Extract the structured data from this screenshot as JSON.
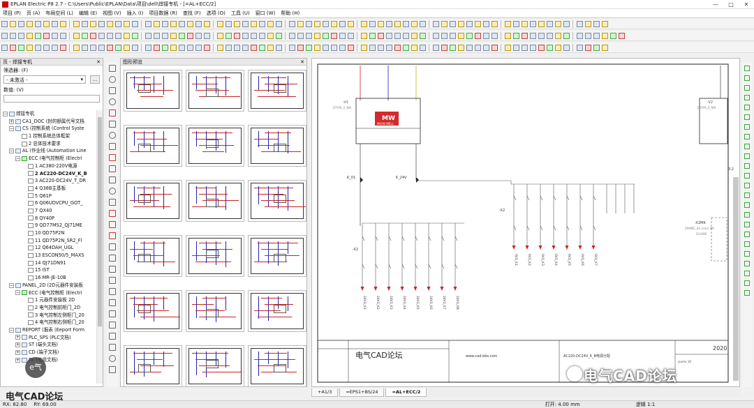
{
  "window": {
    "title": "EPLAN Electric P8 2.7 - C:\\Users\\Public\\EPLAN\\Data\\项目\\dell\\焊接专机 - [=AL+ECC/2]",
    "controls": [
      "—",
      "□",
      "✕"
    ]
  },
  "menu": [
    "项目 (P)",
    "页 (A)",
    "布局空间 (L)",
    "编辑 (E)",
    "视图 (V)",
    "插入 (I)",
    "项目数据 (R)",
    "查找 (F)",
    "选项 (O)",
    "工具 (U)",
    "窗口 (W)",
    "帮助 (H)"
  ],
  "left_panel": {
    "header": "页 - 焊接专机",
    "filter_label": "筛选器: (F)",
    "filter_value": "- 未激活 -",
    "filter_btn": "...",
    "value_label": "数值: (V)",
    "tree": [
      {
        "depth": 0,
        "toggle": "⊟",
        "icon": "proj",
        "label": "焊接专机"
      },
      {
        "depth": 1,
        "toggle": "⊞",
        "icon": "folder",
        "label": "CA1_DOC (封的额属代号文档"
      },
      {
        "depth": 1,
        "toggle": "⊟",
        "icon": "folder",
        "label": "CS (控制系统 (Control Syste"
      },
      {
        "depth": 2,
        "toggle": "",
        "icon": "page",
        "label": "1 控制系统总体框架"
      },
      {
        "depth": 2,
        "toggle": "",
        "icon": "page",
        "label": "2 总体技术要求"
      },
      {
        "depth": 1,
        "toggle": "⊟",
        "icon": "folder",
        "label": "AL (作业线 (Automation Line"
      },
      {
        "depth": 2,
        "toggle": "⊟",
        "icon": "green",
        "label": "ECC (电气控制柜 (Electri"
      },
      {
        "depth": 3,
        "toggle": "",
        "icon": "page",
        "label": "1 AC380-220V电源"
      },
      {
        "depth": 3,
        "toggle": "",
        "icon": "page",
        "label": "2 AC220-DC24V_K_B",
        "bold": true
      },
      {
        "depth": 3,
        "toggle": "",
        "icon": "page",
        "label": "3 AC220-DC24V_T_DR"
      },
      {
        "depth": 3,
        "toggle": "",
        "icon": "page",
        "label": "4 Q38B主基板"
      },
      {
        "depth": 3,
        "toggle": "",
        "icon": "page",
        "label": "5 Q61P"
      },
      {
        "depth": 3,
        "toggle": "",
        "icon": "page",
        "label": "6 Q06UDVCPU_GOT_"
      },
      {
        "depth": 3,
        "toggle": "",
        "icon": "page",
        "label": "7 QX40"
      },
      {
        "depth": 3,
        "toggle": "",
        "icon": "page",
        "label": "8 QY40P"
      },
      {
        "depth": 3,
        "toggle": "",
        "icon": "page",
        "label": "9 QD77MS2_QJ71ME"
      },
      {
        "depth": 3,
        "toggle": "",
        "icon": "page",
        "label": "10 QD75P2N"
      },
      {
        "depth": 3,
        "toggle": "",
        "icon": "page",
        "label": "11 QD75P2N_SR2_Fl"
      },
      {
        "depth": 3,
        "toggle": "",
        "icon": "page",
        "label": "12 Q64DAH_UGL"
      },
      {
        "depth": 3,
        "toggle": "",
        "icon": "page",
        "label": "13 ESCON50/5_MAXS"
      },
      {
        "depth": 3,
        "toggle": "",
        "icon": "page",
        "label": "14 QJ71DN91"
      },
      {
        "depth": 3,
        "toggle": "",
        "icon": "page",
        "label": "15 IST"
      },
      {
        "depth": 3,
        "toggle": "",
        "icon": "page",
        "label": "16 MR-JE-10B"
      },
      {
        "depth": 1,
        "toggle": "⊟",
        "icon": "folder",
        "label": "PANEL_2D (2D元器件安装板"
      },
      {
        "depth": 2,
        "toggle": "⊟",
        "icon": "green",
        "label": "ECC (电气控制柜 (Electri"
      },
      {
        "depth": 3,
        "toggle": "",
        "icon": "page",
        "label": "1 元器件安装板 2D"
      },
      {
        "depth": 3,
        "toggle": "",
        "icon": "page",
        "label": "2 电气控制前柜门_2D"
      },
      {
        "depth": 3,
        "toggle": "",
        "icon": "page",
        "label": "3 电气控制左侧柜门_20"
      },
      {
        "depth": 3,
        "toggle": "",
        "icon": "page",
        "label": "4 电气控制右侧柜门_20"
      },
      {
        "depth": 1,
        "toggle": "⊟",
        "icon": "folder",
        "label": "REPORT (报表 (Eeport Form"
      },
      {
        "depth": 2,
        "toggle": "⊞",
        "icon": "folder",
        "label": "PLC_SPS (PLC文档)"
      },
      {
        "depth": 2,
        "toggle": "⊞",
        "icon": "folder",
        "label": "ST (端头文档)"
      },
      {
        "depth": 2,
        "toggle": "⊞",
        "icon": "folder",
        "label": "CD (端子文档)"
      },
      {
        "depth": 2,
        "toggle": "⊞",
        "icon": "folder",
        "label": "BL (电缆文档)"
      }
    ]
  },
  "thumb_panel": {
    "header": "图形预览"
  },
  "canvas": {
    "page_title_block": {
      "company": "电气CAD论坛",
      "website": "www.cad-bbs.com",
      "page_desc": "AC220-DC24V_K_B电源分配",
      "year": "2020",
      "footer_small": "jaume 18"
    },
    "labels": {
      "v1": "-V1",
      "v2": "-V2",
      "v1sub": "DTYPE_0_NRI",
      "v2sub": "DTYPE_0_NRI",
      "k01": "K_01",
      "k24": "K_24V",
      "x2left": "-X2",
      "x2right": "-X2",
      "x2mk": "-X2MK",
      "brand": "MW",
      "brand_sub": "MEAN WELL",
      "rhs_small": "3.2",
      "rhs_desc": "2RMMC_84 (mm)  VM",
      "rhs_desc2": "SCHIME"
    },
    "left_wires": [
      "24V1_K1",
      "24V1_K2",
      "24V1_K3",
      "24V1_K4",
      "24V1_K5",
      "24V1_K6",
      "24V1_K7",
      "24V1_K8"
    ],
    "right_wires": [
      "0V1_K1",
      "0V1_K2",
      "0V1_K3",
      "0V1_K4",
      "0V1_K5",
      "0V1_K6",
      "0V1_K7"
    ]
  },
  "bottom_tabs": [
    "+A1/3",
    "=EPS1+BS/24",
    "=AL+ECC/2"
  ],
  "status": {
    "rx": "RX: 82.80",
    "ry": "RY: 69.00",
    "grid": "打开: 4.00 mm",
    "scale": "逻辑 1:1"
  },
  "watermarks": {
    "left": "电气CAD论坛",
    "left_circle": "e气",
    "right": "电气CAD论坛"
  },
  "colors": {
    "wire_red": "#cc2222",
    "wire_blue": "#2233aa",
    "highlight": "#4a90e2",
    "brand_red": "#d22b2b"
  }
}
